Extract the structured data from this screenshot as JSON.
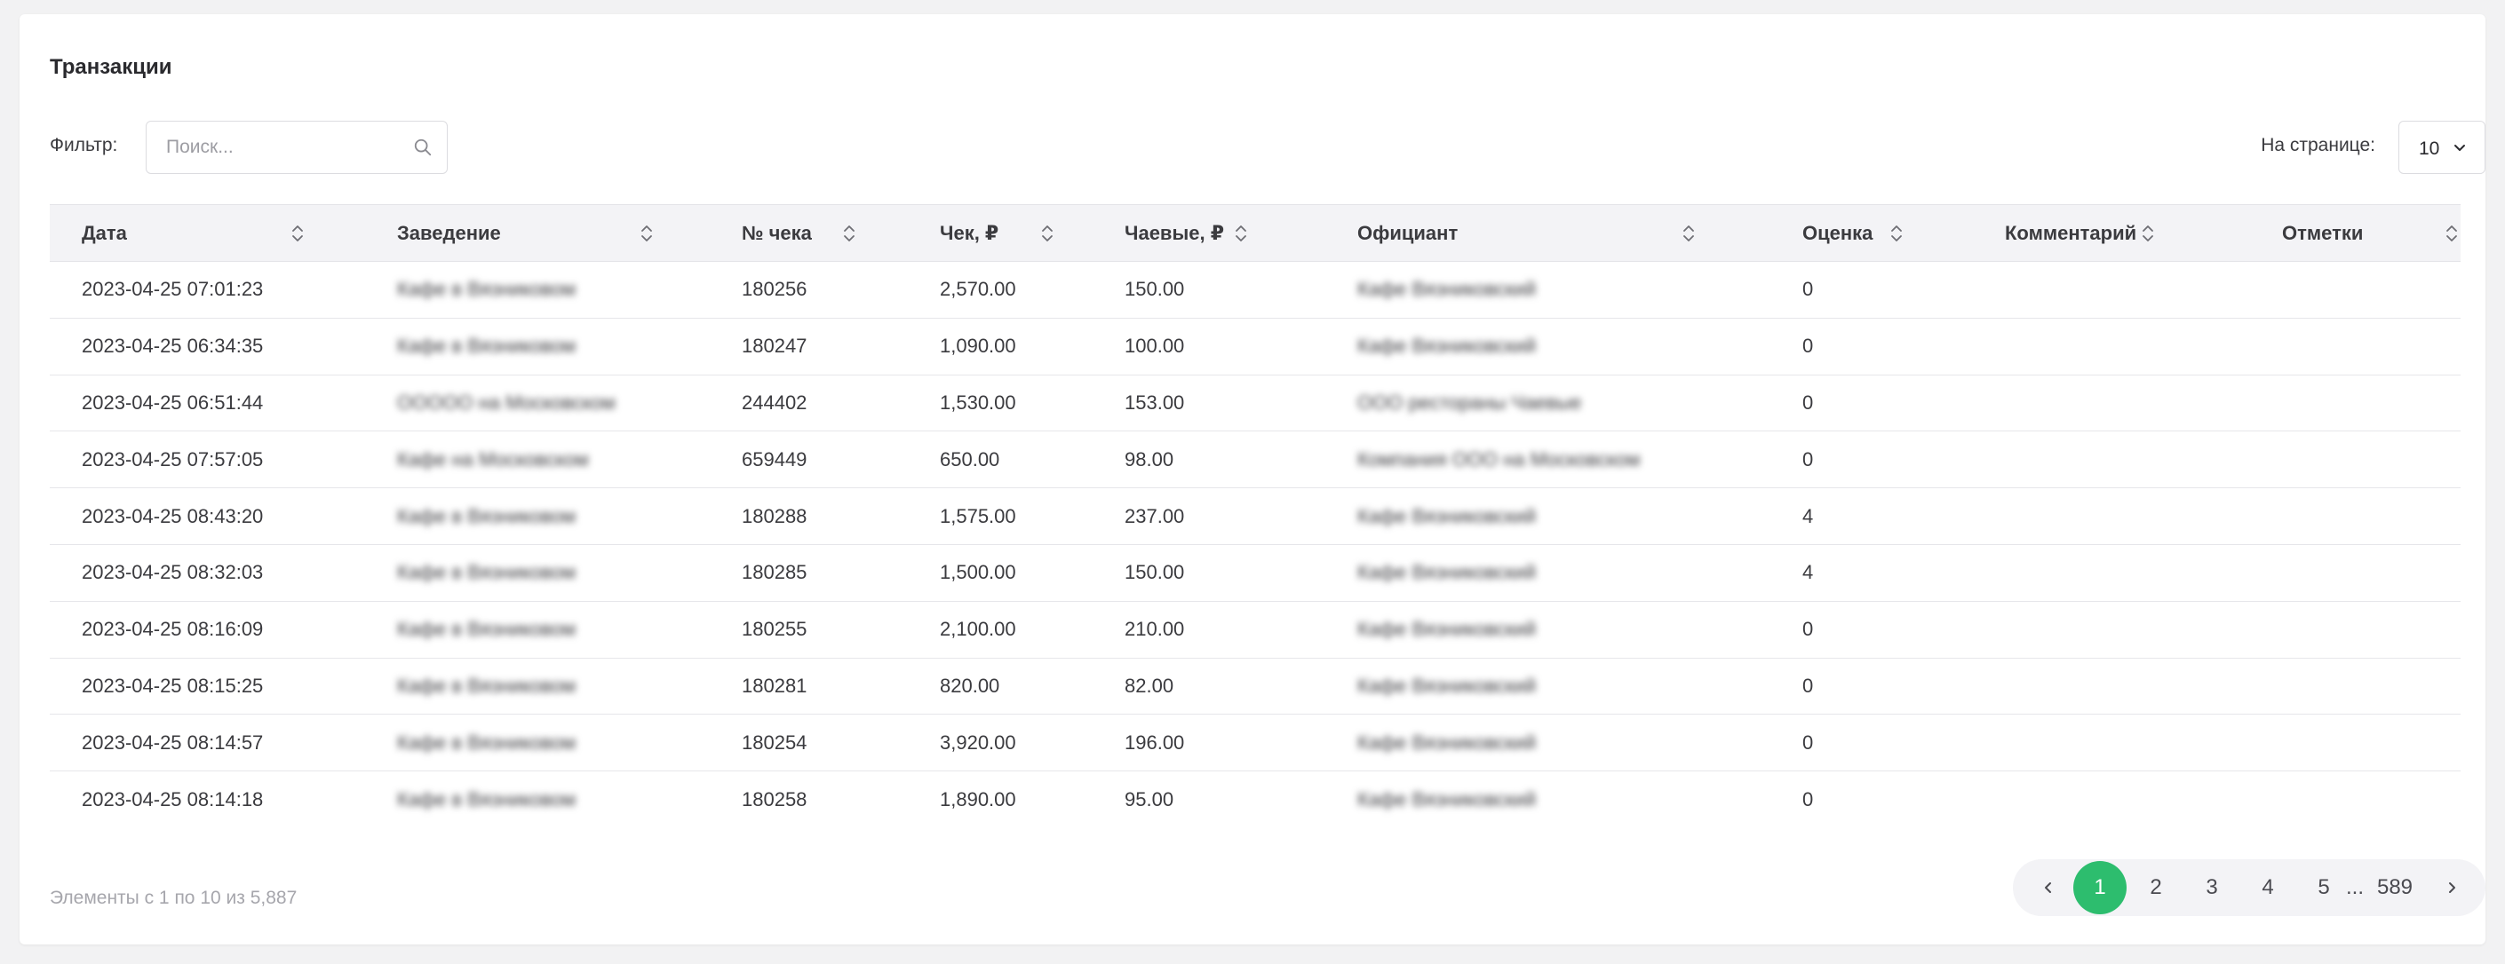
{
  "header": {
    "title": "Транзакции"
  },
  "filter": {
    "label": "Фильтр:",
    "placeholder": "Поиск...",
    "value": ""
  },
  "per_page": {
    "label": "На странице:",
    "value": "10"
  },
  "table": {
    "columns": [
      "Дата",
      "Заведение",
      "№ чека",
      "Чек, ₽",
      "Чаевые, ₽",
      "Официант",
      "Оценка",
      "Комментарий",
      "Отметки"
    ],
    "rows": [
      [
        "2023-04-25 07:01:23",
        "Кафе в Вязниковом",
        "180256",
        "2,570.00",
        "150.00",
        "Кафе Вязниковский",
        "0",
        "",
        ""
      ],
      [
        "2023-04-25 06:34:35",
        "Кафе в Вязниковом",
        "180247",
        "1,090.00",
        "100.00",
        "Кафе Вязниковский",
        "0",
        "",
        ""
      ],
      [
        "2023-04-25 06:51:44",
        "ООООО на Московском",
        "244402",
        "1,530.00",
        "153.00",
        "ООО рестораны Чаевые",
        "0",
        "",
        ""
      ],
      [
        "2023-04-25 07:57:05",
        "Кафе на Московском",
        "659449",
        "650.00",
        "98.00",
        "Компания ООО на Московском",
        "0",
        "",
        ""
      ],
      [
        "2023-04-25 08:43:20",
        "Кафе в Вязниковом",
        "180288",
        "1,575.00",
        "237.00",
        "Кафе Вязниковский",
        "4",
        "",
        ""
      ],
      [
        "2023-04-25 08:32:03",
        "Кафе в Вязниковом",
        "180285",
        "1,500.00",
        "150.00",
        "Кафе Вязниковский",
        "4",
        "",
        ""
      ],
      [
        "2023-04-25 08:16:09",
        "Кафе в Вязниковом",
        "180255",
        "2,100.00",
        "210.00",
        "Кафе Вязниковский",
        "0",
        "",
        ""
      ],
      [
        "2023-04-25 08:15:25",
        "Кафе в Вязниковом",
        "180281",
        "820.00",
        "82.00",
        "Кафе Вязниковский",
        "0",
        "",
        ""
      ],
      [
        "2023-04-25 08:14:57",
        "Кафе в Вязниковом",
        "180254",
        "3,920.00",
        "196.00",
        "Кафе Вязниковский",
        "0",
        "",
        ""
      ],
      [
        "2023-04-25 08:14:18",
        "Кафе в Вязниковом",
        "180258",
        "1,890.00",
        "95.00",
        "Кафе Вязниковский",
        "0",
        "",
        ""
      ]
    ]
  },
  "footer": {
    "info": "Элементы с 1 по 10 из 5,887"
  },
  "pagination": {
    "pages": [
      "1",
      "2",
      "3",
      "4",
      "5"
    ],
    "ellipsis": "...",
    "last": "589",
    "current": "1"
  },
  "colors": {
    "accent": "#2dbd6e",
    "header_bg": "#f3f3f6"
  },
  "icons": {
    "search": "search-icon",
    "sort": "sort-icon",
    "dropdown": "chevron-down-icon",
    "prev": "chevron-left-icon",
    "next": "chevron-right-icon"
  }
}
